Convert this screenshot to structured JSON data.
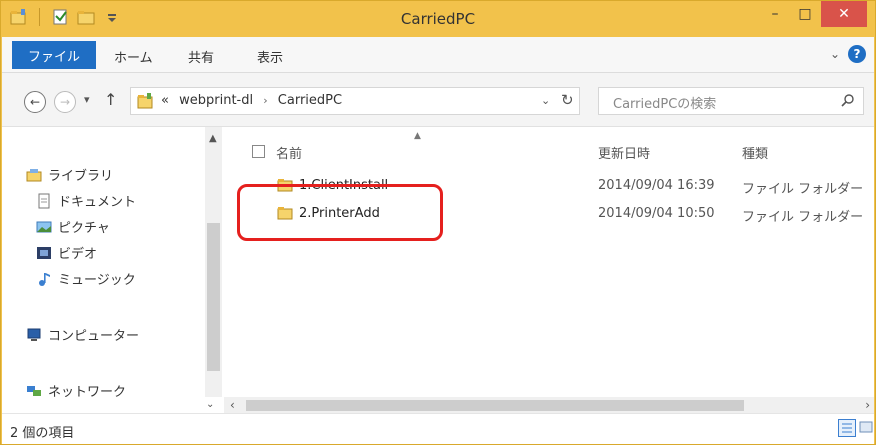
{
  "window": {
    "title": "CarriedPC",
    "controls": {
      "minimize": "–",
      "maximize": "□",
      "close": "✕"
    }
  },
  "ribbon": {
    "tabs": {
      "file": "ファイル",
      "home": "ホーム",
      "share": "共有",
      "view": "表示"
    },
    "expand": "⌄",
    "help": "?"
  },
  "address_bar": {
    "prefix": "«",
    "crumb1": "webprint-dl",
    "sep": "›",
    "crumb2": "CarriedPC",
    "dropdown": "⌄",
    "refresh": "↻"
  },
  "search": {
    "placeholder": "CarriedPCの検索"
  },
  "nav_pane": {
    "libraries": "ライブラリ",
    "documents": "ドキュメント",
    "pictures": "ピクチャ",
    "videos": "ビデオ",
    "music": "ミュージック",
    "computer": "コンピューター",
    "network": "ネットワーク"
  },
  "columns": {
    "name": "名前",
    "date": "更新日時",
    "type": "種類"
  },
  "files": [
    {
      "name": "1.ClientInstall",
      "date": "2014/09/04 16:39",
      "type": "ファイル フォルダー"
    },
    {
      "name": "2.PrinterAdd",
      "date": "2014/09/04 10:50",
      "type": "ファイル フォルダー"
    }
  ],
  "status": {
    "item_count": "2 個の項目"
  },
  "colors": {
    "titlebar": "#f2c24b",
    "file_tab": "#1f6ec4",
    "close_button": "#d9534a",
    "highlight": "#e5201e"
  }
}
